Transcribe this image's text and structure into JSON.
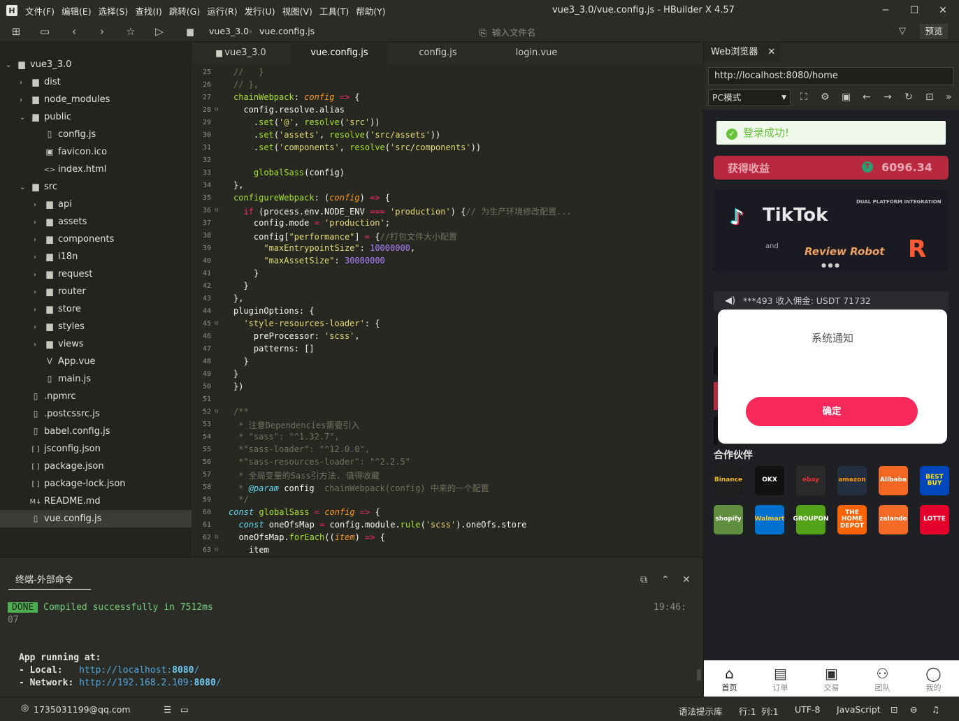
{
  "app": {
    "title": "vue3_3.0/vue.config.js - HBuilder X 4.57",
    "logo": "H"
  },
  "menu": [
    "文件(F)",
    "编辑(E)",
    "选择(S)",
    "查找(I)",
    "跳转(G)",
    "运行(R)",
    "发行(U)",
    "视图(V)",
    "工具(T)",
    "帮助(Y)"
  ],
  "toolbar": {
    "breadcrumb": [
      "vue3_3.0",
      "vue.config.js"
    ],
    "open_file_placeholder": "输入文件名",
    "preview": "预览"
  },
  "file_tree": [
    {
      "label": "vue3_3.0",
      "level": 0,
      "type": "folder-open"
    },
    {
      "label": "dist",
      "level": 1,
      "type": "folder"
    },
    {
      "label": "node_modules",
      "level": 1,
      "type": "folder"
    },
    {
      "label": "public",
      "level": 1,
      "type": "folder-open"
    },
    {
      "label": "config.js",
      "level": 2,
      "type": "file"
    },
    {
      "label": "favicon.ico",
      "level": 2,
      "type": "image"
    },
    {
      "label": "index.html",
      "level": 2,
      "type": "html"
    },
    {
      "label": "src",
      "level": 1,
      "type": "folder-open"
    },
    {
      "label": "api",
      "level": 2,
      "type": "folder"
    },
    {
      "label": "assets",
      "level": 2,
      "type": "folder"
    },
    {
      "label": "components",
      "level": 2,
      "type": "folder"
    },
    {
      "label": "i18n",
      "level": 2,
      "type": "folder"
    },
    {
      "label": "request",
      "level": 2,
      "type": "folder"
    },
    {
      "label": "router",
      "level": 2,
      "type": "folder"
    },
    {
      "label": "store",
      "level": 2,
      "type": "folder"
    },
    {
      "label": "styles",
      "level": 2,
      "type": "folder"
    },
    {
      "label": "views",
      "level": 2,
      "type": "folder"
    },
    {
      "label": "App.vue",
      "level": 2,
      "type": "vue"
    },
    {
      "label": "main.js",
      "level": 2,
      "type": "file"
    },
    {
      "label": ".npmrc",
      "level": 1,
      "type": "file"
    },
    {
      "label": ".postcssrc.js",
      "level": 1,
      "type": "file"
    },
    {
      "label": "babel.config.js",
      "level": 1,
      "type": "file"
    },
    {
      "label": "jsconfig.json",
      "level": 1,
      "type": "json"
    },
    {
      "label": "package.json",
      "level": 1,
      "type": "json"
    },
    {
      "label": "package-lock.json",
      "level": 1,
      "type": "json"
    },
    {
      "label": "README.md",
      "level": 1,
      "type": "md"
    },
    {
      "label": "vue.config.js",
      "level": 1,
      "type": "file",
      "selected": true
    }
  ],
  "editor_tabs": [
    {
      "label": "vue3_3.0"
    },
    {
      "label": "vue.config.js",
      "active": true
    },
    {
      "label": "config.js"
    },
    {
      "label": "login.vue"
    }
  ],
  "code_lines": [
    {
      "n": "25",
      "h": "<span class='c'>//   }</span>"
    },
    {
      "n": "26",
      "h": "<span class='c'>// },</span>"
    },
    {
      "n": "27",
      "h": "<span class='f'>chainWebpack</span>: <span class='v'>config</span> <span class='k'>=&gt;</span> {"
    },
    {
      "n": "28",
      "fold": true,
      "h": "  config.resolve.alias"
    },
    {
      "n": "29",
      "h": "    .<span class='f'>set</span>(<span class='s'>'@'</span>, <span class='f'>resolve</span>(<span class='s'>'src'</span>))"
    },
    {
      "n": "30",
      "h": "    .<span class='f'>set</span>(<span class='s'>'assets'</span>, <span class='f'>resolve</span>(<span class='s'>'src/assets'</span>))"
    },
    {
      "n": "31",
      "h": "    .<span class='f'>set</span>(<span class='s'>'components'</span>, <span class='f'>resolve</span>(<span class='s'>'src/components'</span>))"
    },
    {
      "n": "32",
      "h": ""
    },
    {
      "n": "33",
      "h": "    <span class='f'>globalSass</span>(config)"
    },
    {
      "n": "34",
      "h": "},"
    },
    {
      "n": "35",
      "h": "<span class='f'>configureWebpack</span>: (<span class='v'>config</span>) <span class='k'>=&gt;</span> {"
    },
    {
      "n": "36",
      "fold": true,
      "h": "  <span class='k'>if</span> (process.env.NODE_ENV <span class='k'>===</span> <span class='s'>'production'</span>) {<span class='c'>// 为生产环境修改配置...</span>"
    },
    {
      "n": "37",
      "h": "    config.mode <span class='k'>=</span> <span class='s'>'production'</span>;"
    },
    {
      "n": "38",
      "h": "    config[<span class='s'>\"performance\"</span>] <span class='k'>=</span> {<span class='c'>//打包文件大小配置</span>"
    },
    {
      "n": "39",
      "h": "      <span class='s'>\"maxEntrypointSize\"</span>: <span class='n'>10000000</span>,"
    },
    {
      "n": "40",
      "h": "      <span class='s'>\"maxAssetSize\"</span>: <span class='n'>30000000</span>"
    },
    {
      "n": "41",
      "h": "    }"
    },
    {
      "n": "42",
      "h": "  }"
    },
    {
      "n": "43",
      "h": "},"
    },
    {
      "n": "44",
      "h": "pluginOptions: {"
    },
    {
      "n": "45",
      "fold": true,
      "h": "  <span class='s'>'style-resources-loader'</span>: {"
    },
    {
      "n": "46",
      "h": "    preProcessor: <span class='s'>'scss'</span>,"
    },
    {
      "n": "47",
      "h": "    patterns: []"
    },
    {
      "n": "48",
      "h": "  }"
    },
    {
      "n": "49",
      "h": "}"
    },
    {
      "n": "50",
      "h": "})"
    },
    {
      "n": "51",
      "h": ""
    },
    {
      "n": "52",
      "fold": true,
      "h": "<span class='c'>/**</span>"
    },
    {
      "n": "53",
      "h": "<span class='c'> * 注意Dependencies需要引入</span>"
    },
    {
      "n": "54",
      "h": "<span class='c'> * \"sass\": \"^1.32.7\",</span>"
    },
    {
      "n": "55",
      "h": "<span class='c'> *\"sass-loader\": \"^12.0.0\",</span>"
    },
    {
      "n": "56",
      "h": "<span class='c'> *\"sass-resources-loader\": \"^2.2.5\"</span>"
    },
    {
      "n": "57",
      "h": "<span class='c'> * 全局变量的Sass引方法. 值得收藏</span>"
    },
    {
      "n": "58",
      "h": "<span class='c'> * </span><span class='p'>@param</span> config  <span class='c'>chainWebpack(config) 中来的一个配置</span>"
    },
    {
      "n": "59",
      "h": "<span class='c'> */</span>"
    },
    {
      "n": "60",
      "h": "<span class='p'>const</span> <span class='f'>globalSass</span> <span class='k'>=</span> <span class='v'>config</span> <span class='k'>=&gt;</span> {"
    },
    {
      "n": "61",
      "h": "  <span class='p'>const</span> oneOfsMap <span class='k'>=</span> config.module.<span class='f'>rule</span>(<span class='s'>'scss'</span>).oneOfs.store"
    },
    {
      "n": "62",
      "fold": true,
      "h": "  oneOfsMap.<span class='f'>forEach</span>((<span class='v'>item</span>) <span class='k'>=&gt;</span> {"
    },
    {
      "n": "63",
      "fold": true,
      "h": "    item"
    }
  ],
  "browser": {
    "tab": "Web浏览器",
    "url": "http://localhost:8080/home",
    "mode": "PC模式",
    "toast": "登录成功!",
    "earn_label": "获得收益",
    "earn_value": "6096.34",
    "banner": {
      "top_text": "DUAL PLATFORM INTEGRATION",
      "brand": "TikTok",
      "and": "and",
      "robot": "Review Robot"
    },
    "notice": "***493 收入佣金: USDT 71732",
    "dialog": {
      "title": "系统通知",
      "button": "确定"
    },
    "partners_title": "合作伙伴",
    "partners": [
      "Binance",
      "OKX",
      "ebay",
      "amazon",
      "Alibaba",
      "BEST BUY",
      "shopify",
      "Walmart",
      "GROUPON",
      "THE HOME DEPOT",
      "zalando",
      "LOTTE"
    ],
    "tabbar": [
      {
        "icon": "home-icon",
        "label": "首页"
      },
      {
        "icon": "order-icon",
        "label": "订单"
      },
      {
        "icon": "robot-icon",
        "label": "交易"
      },
      {
        "icon": "team-icon",
        "label": "团队"
      },
      {
        "icon": "user-icon",
        "label": "我的"
      }
    ]
  },
  "terminal": {
    "tab": "终端-外部命令",
    "done": "DONE",
    "compiled": "Compiled successfully in 7512ms",
    "time": "19:46:",
    "time2": "07",
    "running": "App running at:",
    "local_label": "- Local:   ",
    "local_url": "http://localhost:",
    "local_port": "8080",
    "network_label": "- Network: ",
    "network_url": "http://192.168.2.109:",
    "network_port": "8080"
  },
  "status": {
    "user": "1735031199@qq.com",
    "syntax": "语法提示库",
    "line": "行:1",
    "col": "列:1",
    "encoding": "UTF-8",
    "lang": "JavaScript"
  }
}
